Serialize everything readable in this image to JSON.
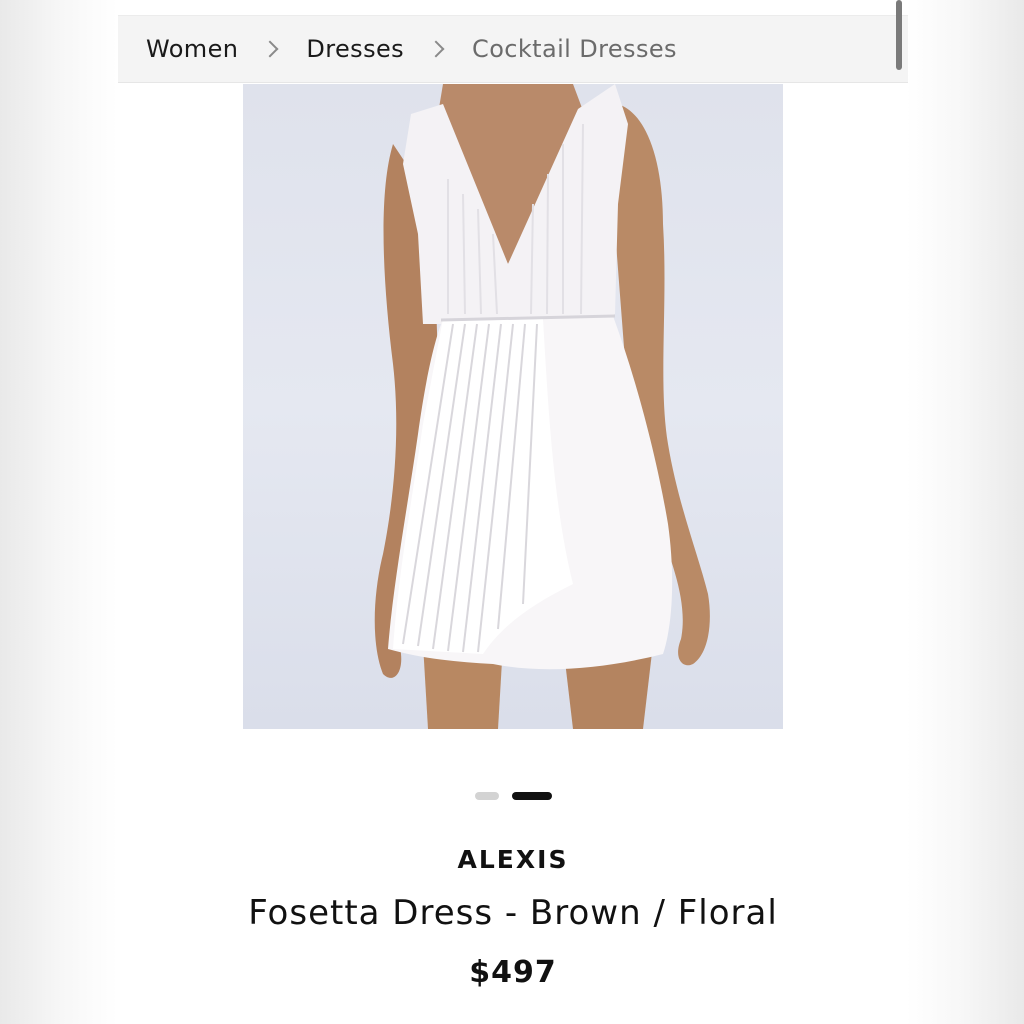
{
  "breadcrumb": {
    "items": [
      {
        "label": "Women"
      },
      {
        "label": "Dresses"
      },
      {
        "label": "Cocktail Dresses"
      }
    ]
  },
  "carousel": {
    "image_count": 2,
    "active_index": 1
  },
  "product": {
    "brand": "ALEXIS",
    "name": "Fosetta Dress - Brown / Floral",
    "price": "$497"
  }
}
